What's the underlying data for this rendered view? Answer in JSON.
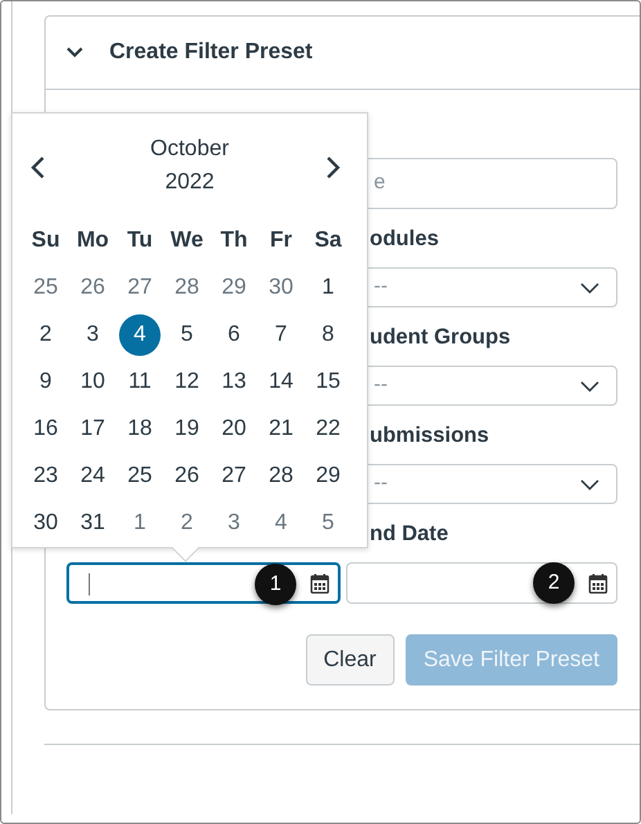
{
  "section": {
    "title": "Create Filter Preset",
    "expanded": true
  },
  "form": {
    "name_field": {
      "placeholder": "e"
    },
    "selects": [
      {
        "label": "odules",
        "value": "--"
      },
      {
        "label": "udent Groups",
        "value": "--"
      },
      {
        "label": "ubmissions",
        "value": "--"
      }
    ],
    "date_label": "nd Date",
    "date_fields": [
      {
        "focused": true,
        "callout": "1"
      },
      {
        "focused": false,
        "callout": "2"
      }
    ],
    "buttons": [
      {
        "label": "Clear",
        "disabled": false
      },
      {
        "label": "Save Filter Preset",
        "disabled": true
      }
    ]
  },
  "calendar": {
    "month": "October",
    "year": "2022",
    "weekdays": [
      "Su",
      "Mo",
      "Tu",
      "We",
      "Th",
      "Fr",
      "Sa"
    ],
    "weeks": [
      [
        {
          "day": "25",
          "outside": true,
          "selected": false
        },
        {
          "day": "26",
          "outside": true,
          "selected": false
        },
        {
          "day": "27",
          "outside": true,
          "selected": false
        },
        {
          "day": "28",
          "outside": true,
          "selected": false
        },
        {
          "day": "29",
          "outside": true,
          "selected": false
        },
        {
          "day": "30",
          "outside": true,
          "selected": false
        },
        {
          "day": "1",
          "outside": false,
          "selected": false
        }
      ],
      [
        {
          "day": "2",
          "outside": false,
          "selected": false
        },
        {
          "day": "3",
          "outside": false,
          "selected": false
        },
        {
          "day": "4",
          "outside": false,
          "selected": true
        },
        {
          "day": "5",
          "outside": false,
          "selected": false
        },
        {
          "day": "6",
          "outside": false,
          "selected": false
        },
        {
          "day": "7",
          "outside": false,
          "selected": false
        },
        {
          "day": "8",
          "outside": false,
          "selected": false
        }
      ],
      [
        {
          "day": "9",
          "outside": false,
          "selected": false
        },
        {
          "day": "10",
          "outside": false,
          "selected": false
        },
        {
          "day": "11",
          "outside": false,
          "selected": false
        },
        {
          "day": "12",
          "outside": false,
          "selected": false
        },
        {
          "day": "13",
          "outside": false,
          "selected": false
        },
        {
          "day": "14",
          "outside": false,
          "selected": false
        },
        {
          "day": "15",
          "outside": false,
          "selected": false
        }
      ],
      [
        {
          "day": "16",
          "outside": false,
          "selected": false
        },
        {
          "day": "17",
          "outside": false,
          "selected": false
        },
        {
          "day": "18",
          "outside": false,
          "selected": false
        },
        {
          "day": "19",
          "outside": false,
          "selected": false
        },
        {
          "day": "20",
          "outside": false,
          "selected": false
        },
        {
          "day": "21",
          "outside": false,
          "selected": false
        },
        {
          "day": "22",
          "outside": false,
          "selected": false
        }
      ],
      [
        {
          "day": "23",
          "outside": false,
          "selected": false
        },
        {
          "day": "24",
          "outside": false,
          "selected": false
        },
        {
          "day": "25",
          "outside": false,
          "selected": false
        },
        {
          "day": "26",
          "outside": false,
          "selected": false
        },
        {
          "day": "27",
          "outside": false,
          "selected": false
        },
        {
          "day": "28",
          "outside": false,
          "selected": false
        },
        {
          "day": "29",
          "outside": false,
          "selected": false
        }
      ],
      [
        {
          "day": "30",
          "outside": false,
          "selected": false
        },
        {
          "day": "31",
          "outside": false,
          "selected": false
        },
        {
          "day": "1",
          "outside": true,
          "selected": false
        },
        {
          "day": "2",
          "outside": true,
          "selected": false
        },
        {
          "day": "3",
          "outside": true,
          "selected": false
        },
        {
          "day": "4",
          "outside": true,
          "selected": false
        },
        {
          "day": "5",
          "outside": true,
          "selected": false
        }
      ]
    ]
  }
}
